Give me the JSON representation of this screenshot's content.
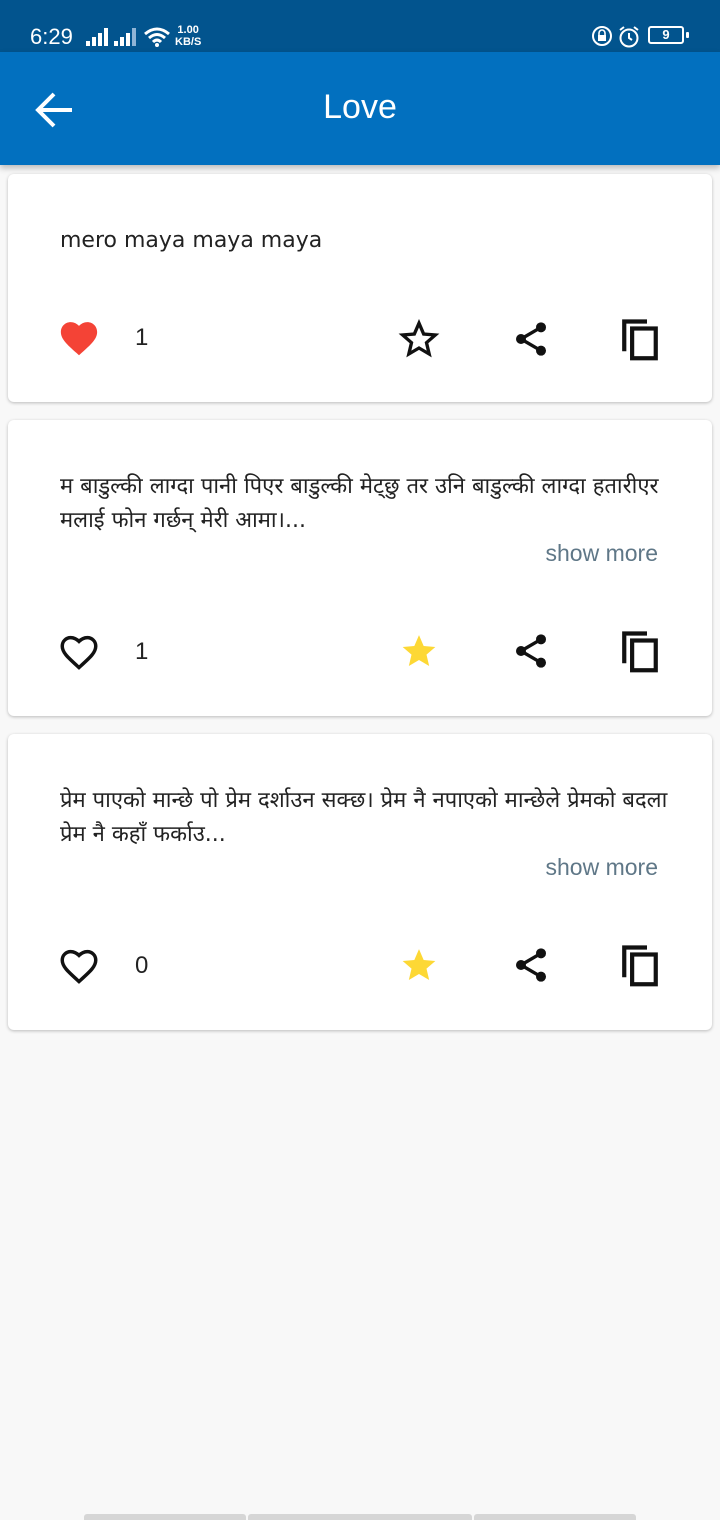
{
  "status_bar": {
    "time": "6:29",
    "net_speed_value": "1.00",
    "net_speed_unit": "KB/S",
    "battery": "9"
  },
  "app_bar": {
    "title": "Love",
    "back_icon": "arrow-back-icon"
  },
  "quotes": [
    {
      "text": "mero maya maya maya",
      "show_more": "",
      "like_count": "1",
      "liked": true,
      "favorited": false
    },
    {
      "text": "म बाडुल्की लाग्दा पानी पिएर बाडुल्की मेट्छु तर उनि बाडुल्की लाग्दा हतारीएर मलाई फोन गर्छन् मेरी आमा।...",
      "show_more": "show more",
      "like_count": "1",
      "liked": false,
      "favorited": true
    },
    {
      "text": "प्रेम पाएको मान्छे पो प्रेम दर्शाउन सक्छ। प्रेम नै नपाएको मान्छेले प्रेमको बदला प्रेम नै कहाँ फर्काउ...",
      "show_more": "show more",
      "like_count": "0",
      "liked": false,
      "favorited": true
    }
  ],
  "colors": {
    "status_bar": "#02548e",
    "app_bar": "#0270bf",
    "heart_filled": "#f44336",
    "star_filled": "#fdd835",
    "show_more": "#5f7787",
    "background": "#f8f8f8"
  },
  "icons": [
    "heart-icon",
    "star-icon",
    "share-icon",
    "copy-icon"
  ]
}
